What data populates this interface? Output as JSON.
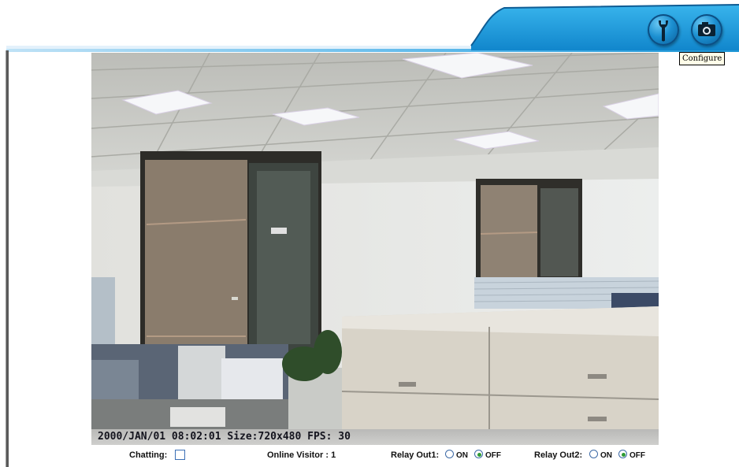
{
  "header": {
    "buttons": [
      {
        "icon": "wrench-icon"
      },
      {
        "icon": "camera-icon"
      }
    ],
    "tooltip": "Configure",
    "band_color": "#1e9ad6"
  },
  "video": {
    "osd": {
      "date": "2000/JAN/01",
      "time": "08:02:01",
      "size_label": "Size:720x480",
      "fps_label": "FPS: 30"
    }
  },
  "status_bar": {
    "chatting_label": "Chatting:",
    "chatting_checked": false,
    "online_visitor_label": "Online Visitor : 1",
    "relay_out1": {
      "label": "Relay Out1:",
      "on_label": "ON",
      "off_label": "OFF",
      "selected": "OFF"
    },
    "relay_out2": {
      "label": "Relay Out2:",
      "on_label": "ON",
      "off_label": "OFF",
      "selected": "OFF"
    }
  }
}
